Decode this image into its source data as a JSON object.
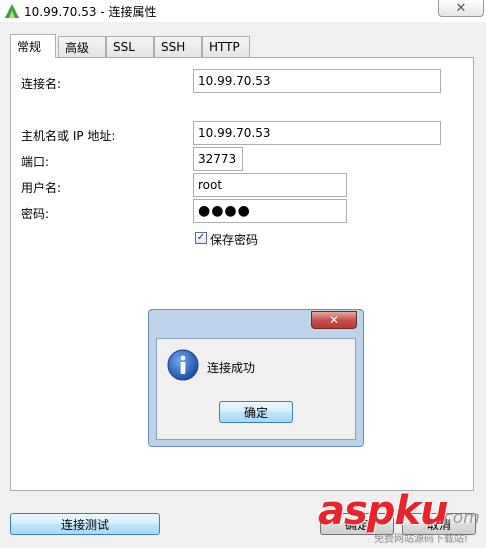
{
  "window": {
    "title": "10.99.70.53 - 连接属性",
    "close_glyph": "✕"
  },
  "tabs": [
    {
      "label": "常规",
      "active": true
    },
    {
      "label": "高级",
      "active": false
    },
    {
      "label": "SSL",
      "active": false
    },
    {
      "label": "SSH",
      "active": false
    },
    {
      "label": "HTTP",
      "active": false
    }
  ],
  "form": {
    "connection_name": {
      "label": "连接名:",
      "value": "10.99.70.53"
    },
    "host": {
      "label": "主机名或 IP 地址:",
      "value": "10.99.70.53"
    },
    "port": {
      "label": "端口:",
      "value": "32773"
    },
    "username": {
      "label": "用户名:",
      "value": "root"
    },
    "password": {
      "label": "密码:",
      "value": "●●●●"
    },
    "save_password": {
      "label": "保存密码",
      "checked": true,
      "check_glyph": "✓"
    }
  },
  "buttons": {
    "test_connection": "连接测试",
    "ok": "确定",
    "cancel": "取消"
  },
  "dialog": {
    "message": "连接成功",
    "ok_label": "确定",
    "close_glyph": "✕"
  },
  "watermark": {
    "text": "aspku",
    "suffix": ".com",
    "subtitle": "免费网站源码下载站!"
  },
  "colors": {
    "dialog_frame": "#bcd3ea",
    "close_red": "#c75050",
    "focus_blue": "#3c7fb1",
    "watermark_red": "#e8232c"
  }
}
